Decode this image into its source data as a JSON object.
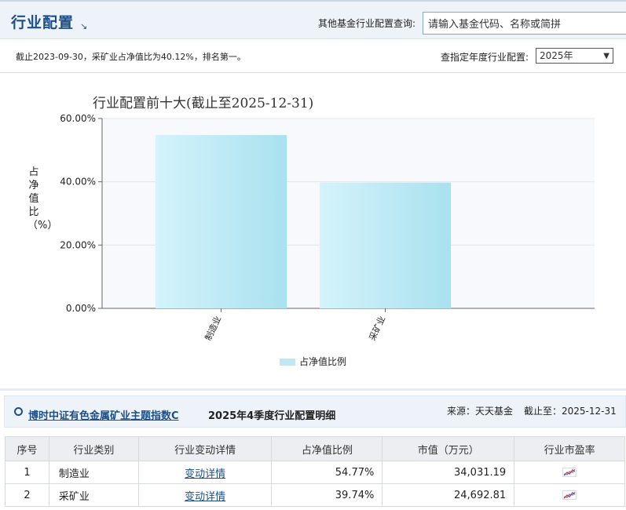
{
  "header": {
    "title": "行业配置",
    "query_label": "其他基金行业配置查询:",
    "search_value": "请输入基金代码、名称或简拼"
  },
  "info": {
    "summary": "截止2023-09-30，采矿业占净值比为40.12%，排名第一。",
    "year_label": "查指定年度行业配置:",
    "year_selected": "2025年"
  },
  "chart_data": {
    "type": "bar",
    "title": "行业配置前十大(截止至2025-12-31)",
    "ylabel": "占净值比（%）",
    "xlabel": "",
    "categories": [
      "制造业",
      "采矿业"
    ],
    "series": [
      {
        "name": "占净值比例",
        "values": [
          54.77,
          39.74
        ]
      }
    ],
    "ylim": [
      0,
      60
    ],
    "yticks": [
      "0.00%",
      "20.00%",
      "40.00%",
      "60.00%"
    ],
    "grid": true,
    "legend": "bottom",
    "bar_color": "#bde8f3"
  },
  "detail": {
    "fund_name": "博时中证有色金属矿业主题指数C",
    "subtitle": "2025年4季度行业配置明细",
    "source": "来源：天天基金",
    "as_of": "截止至：2025-12-31"
  },
  "table": {
    "headers": [
      "序号",
      "行业类别",
      "行业变动详情",
      "占净值比例",
      "市值（万元）",
      "行业市盈率"
    ],
    "rows": [
      {
        "idx": "1",
        "category": "制造业",
        "detail_link": "变动详情",
        "ratio": "54.77%",
        "value": "34,031.19"
      },
      {
        "idx": "2",
        "category": "采矿业",
        "detail_link": "变动详情",
        "ratio": "39.74%",
        "value": "24,692.81"
      }
    ]
  },
  "colors": {
    "accent": "#1b4f8a",
    "header_bg": "#eef3f9"
  }
}
